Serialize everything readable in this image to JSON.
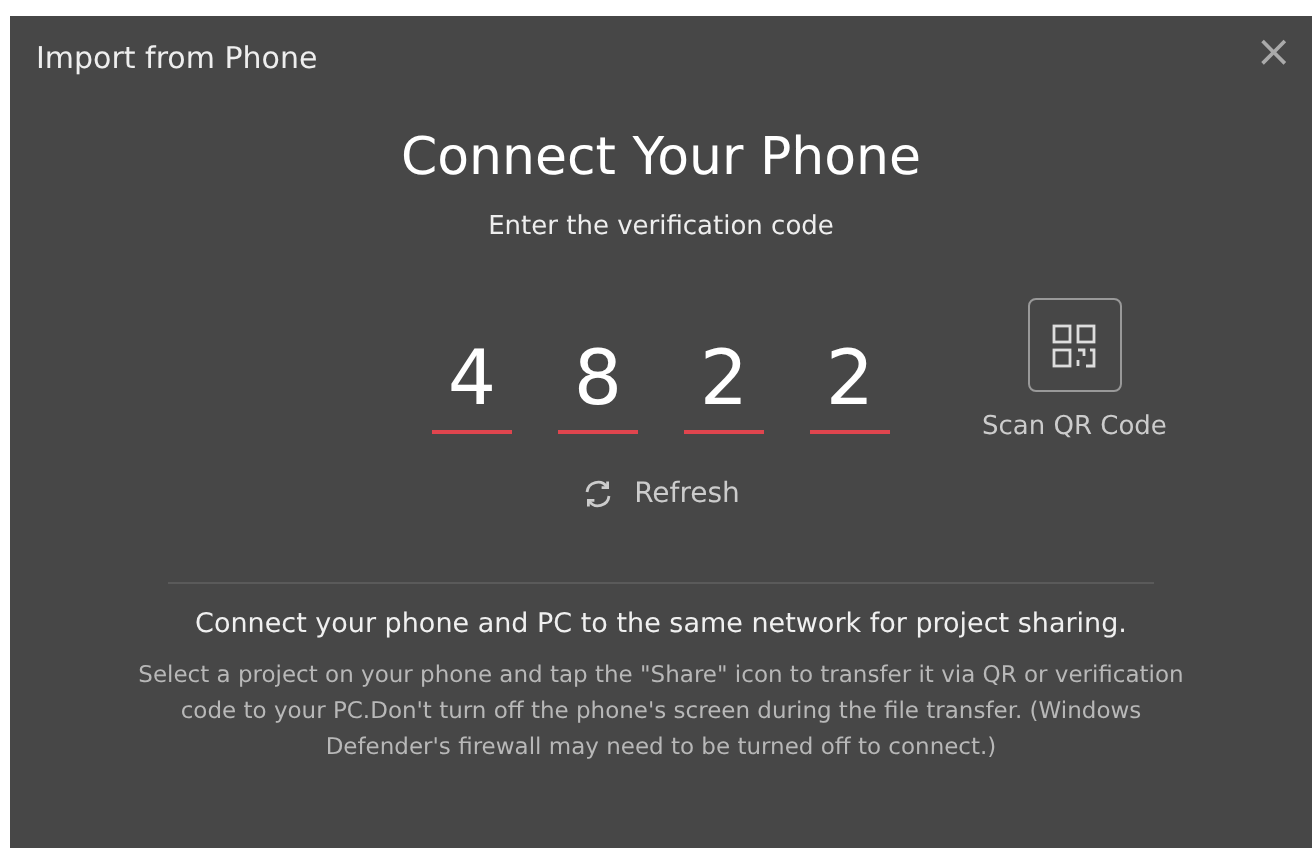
{
  "window": {
    "title": "Import from Phone",
    "close": "×"
  },
  "heading": "Connect Your Phone",
  "subtitle": "Enter the verification code",
  "code_digits": [
    "4",
    "8",
    "2",
    "2"
  ],
  "refresh": {
    "label": "Refresh"
  },
  "qr_button": {
    "label": "Scan QR Code"
  },
  "note": {
    "title": "Connect your phone and PC to the same network for project sharing.",
    "body": "Select a project on your phone and tap the \"Share\" icon to transfer it via QR or verification code to your PC.Don't turn off the phone's screen during the file transfer. (Windows Defender's firewall may need to be turned off to connect.)"
  }
}
